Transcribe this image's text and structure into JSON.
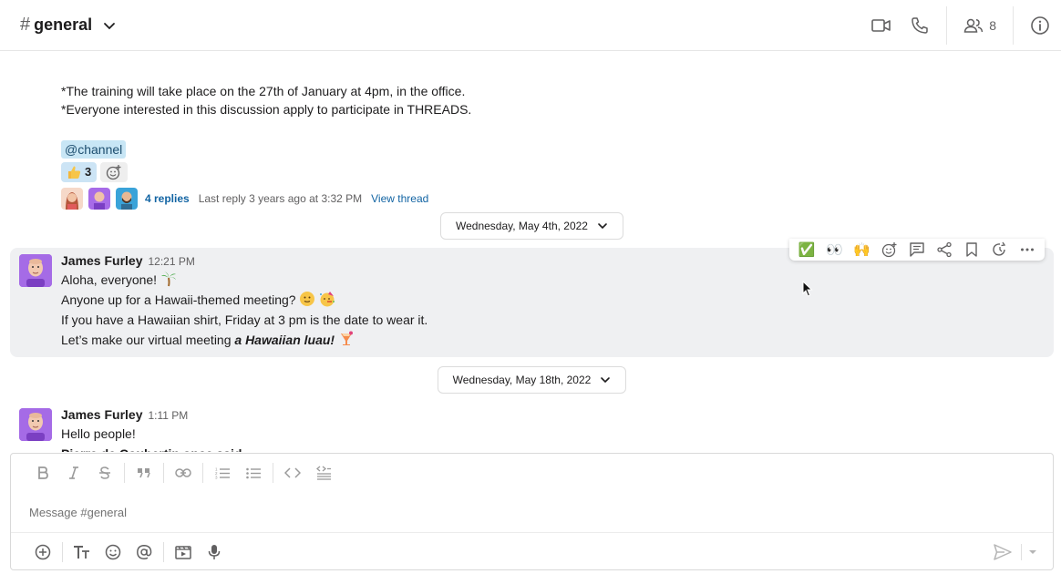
{
  "header": {
    "hash": "#",
    "channel_name": "general",
    "member_count": "8"
  },
  "previous_message": {
    "lines": [
      "*The training will take place on the 27th of January at 4pm, in the office.",
      "*Everyone interested in this discussion apply to participate in THREADS."
    ],
    "mention": "@channel",
    "reaction_count": "3",
    "thread": {
      "replies": "4 replies",
      "last_reply": "Last reply 3 years ago at 3:32 PM",
      "view": "View thread"
    }
  },
  "date_dividers": [
    "Wednesday, May 4th, 2022",
    "Wednesday, May 18th, 2022"
  ],
  "messages": [
    {
      "author": "James Furley",
      "time": "12:21 PM",
      "lines": [
        "Aloha, everyone!",
        "Anyone up for a Hawaii-themed meeting?",
        "If you have a Hawaiian shirt, Friday at 3 pm is the date to wear it.",
        "Let’s make our virtual meeting "
      ],
      "emphasis": "a Hawaiian luau!"
    },
    {
      "author": "James Furley",
      "time": "1:11 PM",
      "lines": [
        "Hello people!",
        "Pierre de Coubertin once said:"
      ]
    }
  ],
  "hover_toolbar": {
    "reactions": [
      "✅",
      "👀",
      "🙌"
    ]
  },
  "composer": {
    "placeholder": "Message #general"
  },
  "icons": {
    "header": [
      "video-icon",
      "phone-icon",
      "members-icon",
      "info-icon"
    ],
    "format": [
      "bold-icon",
      "italic-icon",
      "strikethrough-icon",
      "quote-icon",
      "link-icon",
      "ordered-list-icon",
      "bullet-list-icon",
      "code-icon",
      "code-block-icon"
    ],
    "composer_bottom": [
      "add-icon",
      "text-format-icon",
      "emoji-icon",
      "mention-icon",
      "video-clip-icon",
      "microphone-icon",
      "send-icon"
    ]
  }
}
